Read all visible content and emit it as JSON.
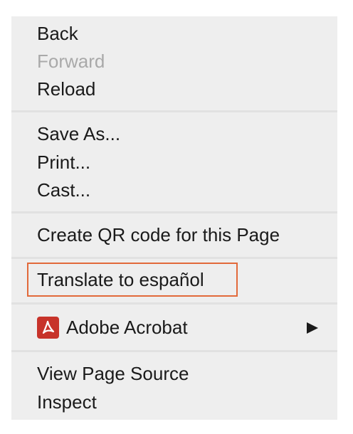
{
  "context_menu": {
    "navigation": {
      "back": "Back",
      "forward": "Forward",
      "reload": "Reload"
    },
    "page_actions": {
      "save_as": "Save As...",
      "print": "Print...",
      "cast": "Cast..."
    },
    "qr_code": "Create QR code for this Page",
    "translate": "Translate to español",
    "extensions": {
      "adobe_acrobat": "Adobe Acrobat",
      "icon": "adobe-acrobat-icon",
      "icon_color": "#c7332a"
    },
    "developer": {
      "view_source": "View Page Source",
      "inspect": "Inspect"
    },
    "highlight_color": "#e2693a"
  }
}
